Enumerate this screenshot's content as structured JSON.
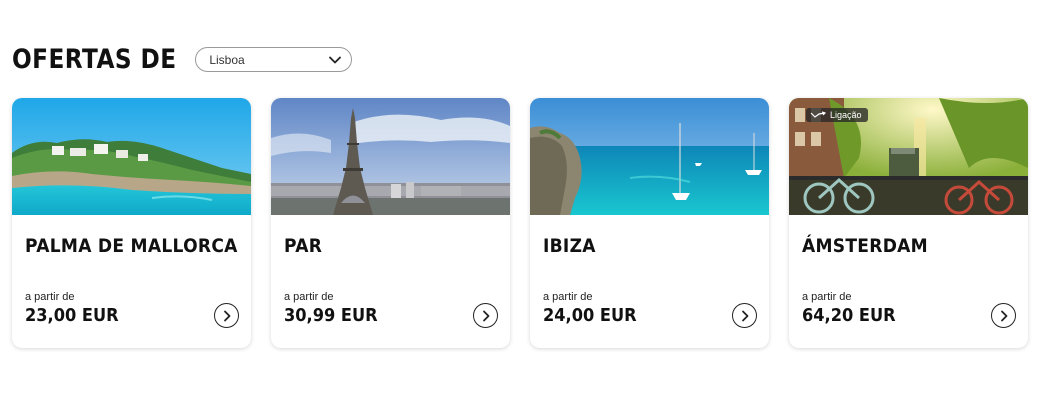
{
  "header": {
    "title": "OFERTAS DE",
    "origin_select": {
      "value": "Lisboa"
    }
  },
  "cards": [
    {
      "title": "PALMA DE MALLORCA",
      "price_label": "a partir de",
      "price": "23,00 EUR"
    },
    {
      "title": "PAR",
      "price_label": "a partir de",
      "price": "30,99 EUR"
    },
    {
      "title": "IBIZA",
      "price_label": "a partir de",
      "price": "24,00 EUR"
    },
    {
      "title": "ÁMSTERDAM",
      "price_label": "a partir de",
      "price": "64,20 EUR",
      "badge": "Ligação"
    }
  ],
  "icons": {
    "select_chevron": "chevron-down-icon",
    "card_arrow": "chevron-right-icon",
    "badge_icon": "connection-flight-icon"
  },
  "colors": {
    "text": "#111111",
    "card_border": "#e3e3e3",
    "select_border": "#9a9a9a"
  }
}
